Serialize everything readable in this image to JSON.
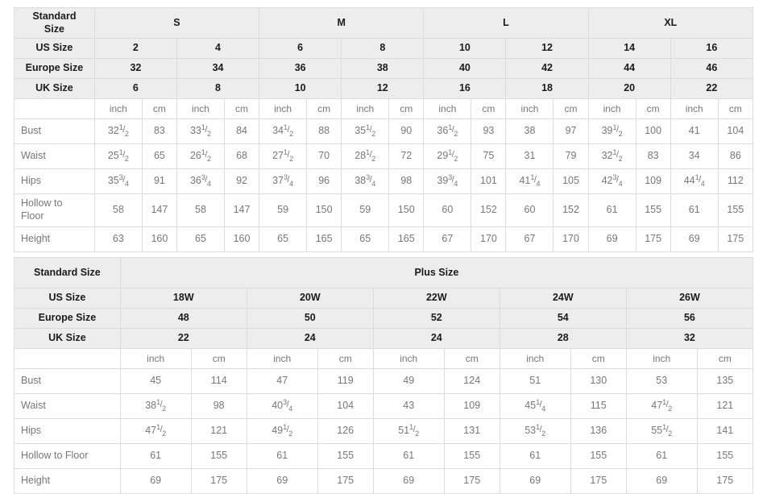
{
  "standard_table": {
    "label_column_header": "Standard\nSize",
    "size_groups": [
      {
        "label": "S",
        "span": 2
      },
      {
        "label": "M",
        "span": 2
      },
      {
        "label": "L",
        "span": 2
      },
      {
        "label": "XL",
        "span": 2
      }
    ],
    "rows": [
      {
        "label": "US Size",
        "values": [
          "2",
          "4",
          "6",
          "8",
          "10",
          "12",
          "14",
          "16"
        ]
      },
      {
        "label": "Europe Size",
        "values": [
          "32",
          "34",
          "36",
          "38",
          "40",
          "42",
          "44",
          "46"
        ]
      },
      {
        "label": "UK Size",
        "values": [
          "6",
          "8",
          "10",
          "12",
          "16",
          "18",
          "20",
          "22"
        ]
      }
    ],
    "unit_row": {
      "label": "",
      "units": [
        "inch",
        "cm",
        "inch",
        "cm",
        "inch",
        "cm",
        "inch",
        "cm",
        "inch",
        "cm",
        "inch",
        "cm",
        "inch",
        "cm",
        "inch",
        "cm"
      ]
    },
    "measurements": [
      {
        "label": "Bust",
        "cells": [
          {
            "whole": "32",
            "num": "1",
            "den": "2"
          },
          {
            "whole": "83"
          },
          {
            "whole": "33",
            "num": "1",
            "den": "2"
          },
          {
            "whole": "84"
          },
          {
            "whole": "34",
            "num": "1",
            "den": "2"
          },
          {
            "whole": "88"
          },
          {
            "whole": "35",
            "num": "1",
            "den": "2"
          },
          {
            "whole": "90"
          },
          {
            "whole": "36",
            "num": "1",
            "den": "2"
          },
          {
            "whole": "93"
          },
          {
            "whole": "38"
          },
          {
            "whole": "97"
          },
          {
            "whole": "39",
            "num": "1",
            "den": "2"
          },
          {
            "whole": "100"
          },
          {
            "whole": "41"
          },
          {
            "whole": "104"
          }
        ]
      },
      {
        "label": "Waist",
        "cells": [
          {
            "whole": "25",
            "num": "1",
            "den": "2"
          },
          {
            "whole": "65"
          },
          {
            "whole": "26",
            "num": "1",
            "den": "2"
          },
          {
            "whole": "68"
          },
          {
            "whole": "27",
            "num": "1",
            "den": "2"
          },
          {
            "whole": "70"
          },
          {
            "whole": "28",
            "num": "1",
            "den": "2"
          },
          {
            "whole": "72"
          },
          {
            "whole": "29",
            "num": "1",
            "den": "2"
          },
          {
            "whole": "75"
          },
          {
            "whole": "31"
          },
          {
            "whole": "79"
          },
          {
            "whole": "32",
            "num": "1",
            "den": "2"
          },
          {
            "whole": "83"
          },
          {
            "whole": "34"
          },
          {
            "whole": "86"
          }
        ]
      },
      {
        "label": "Hips",
        "cells": [
          {
            "whole": "35",
            "num": "3",
            "den": "4"
          },
          {
            "whole": "91"
          },
          {
            "whole": "36",
            "num": "3",
            "den": "4"
          },
          {
            "whole": "92"
          },
          {
            "whole": "37",
            "num": "3",
            "den": "4"
          },
          {
            "whole": "96"
          },
          {
            "whole": "38",
            "num": "3",
            "den": "4"
          },
          {
            "whole": "98"
          },
          {
            "whole": "39",
            "num": "3",
            "den": "4"
          },
          {
            "whole": "101"
          },
          {
            "whole": "41",
            "num": "1",
            "den": "4"
          },
          {
            "whole": "105"
          },
          {
            "whole": "42",
            "num": "3",
            "den": "4"
          },
          {
            "whole": "109"
          },
          {
            "whole": "44",
            "num": "1",
            "den": "4"
          },
          {
            "whole": "112"
          }
        ]
      },
      {
        "label": "Hollow to Floor",
        "cells": [
          {
            "whole": "58"
          },
          {
            "whole": "147"
          },
          {
            "whole": "58"
          },
          {
            "whole": "147"
          },
          {
            "whole": "59"
          },
          {
            "whole": "150"
          },
          {
            "whole": "59"
          },
          {
            "whole": "150"
          },
          {
            "whole": "60"
          },
          {
            "whole": "152"
          },
          {
            "whole": "60"
          },
          {
            "whole": "152"
          },
          {
            "whole": "61"
          },
          {
            "whole": "155"
          },
          {
            "whole": "61"
          },
          {
            "whole": "155"
          }
        ]
      },
      {
        "label": "Height",
        "cells": [
          {
            "whole": "63"
          },
          {
            "whole": "160"
          },
          {
            "whole": "65"
          },
          {
            "whole": "160"
          },
          {
            "whole": "65"
          },
          {
            "whole": "165"
          },
          {
            "whole": "65"
          },
          {
            "whole": "165"
          },
          {
            "whole": "67"
          },
          {
            "whole": "170"
          },
          {
            "whole": "67"
          },
          {
            "whole": "170"
          },
          {
            "whole": "69"
          },
          {
            "whole": "175"
          },
          {
            "whole": "69"
          },
          {
            "whole": "175"
          }
        ]
      }
    ]
  },
  "plus_table": {
    "label_column_header": "Standard Size",
    "group_title": "Plus Size",
    "rows": [
      {
        "label": "US Size",
        "values": [
          "18W",
          "20W",
          "22W",
          "24W",
          "26W"
        ]
      },
      {
        "label": "Europe Size",
        "values": [
          "48",
          "50",
          "52",
          "54",
          "56"
        ]
      },
      {
        "label": "UK Size",
        "values": [
          "22",
          "24",
          "24",
          "28",
          "32"
        ]
      }
    ],
    "unit_row": {
      "label": "",
      "units": [
        "inch",
        "cm",
        "inch",
        "cm",
        "inch",
        "cm",
        "inch",
        "cm",
        "inch",
        "cm"
      ]
    },
    "measurements": [
      {
        "label": "Bust",
        "cells": [
          {
            "whole": "45"
          },
          {
            "whole": "114"
          },
          {
            "whole": "47"
          },
          {
            "whole": "119"
          },
          {
            "whole": "49"
          },
          {
            "whole": "124"
          },
          {
            "whole": "51"
          },
          {
            "whole": "130"
          },
          {
            "whole": "53"
          },
          {
            "whole": "135"
          }
        ]
      },
      {
        "label": "Waist",
        "cells": [
          {
            "whole": "38",
            "num": "1",
            "den": "2"
          },
          {
            "whole": "98"
          },
          {
            "whole": "40",
            "num": "3",
            "den": "4"
          },
          {
            "whole": "104"
          },
          {
            "whole": "43"
          },
          {
            "whole": "109"
          },
          {
            "whole": "45",
            "num": "1",
            "den": "4"
          },
          {
            "whole": "115"
          },
          {
            "whole": "47",
            "num": "1",
            "den": "2"
          },
          {
            "whole": "121"
          }
        ]
      },
      {
        "label": "Hips",
        "cells": [
          {
            "whole": "47",
            "num": "1",
            "den": "2"
          },
          {
            "whole": "121"
          },
          {
            "whole": "49",
            "num": "1",
            "den": "2"
          },
          {
            "whole": "126"
          },
          {
            "whole": "51",
            "num": "1",
            "den": "2"
          },
          {
            "whole": "131"
          },
          {
            "whole": "53",
            "num": "1",
            "den": "2"
          },
          {
            "whole": "136"
          },
          {
            "whole": "55",
            "num": "1",
            "den": "2"
          },
          {
            "whole": "141"
          }
        ]
      },
      {
        "label": "Hollow to Floor",
        "cells": [
          {
            "whole": "61"
          },
          {
            "whole": "155"
          },
          {
            "whole": "61"
          },
          {
            "whole": "155"
          },
          {
            "whole": "61"
          },
          {
            "whole": "155"
          },
          {
            "whole": "61"
          },
          {
            "whole": "155"
          },
          {
            "whole": "61"
          },
          {
            "whole": "155"
          }
        ]
      },
      {
        "label": "Height",
        "cells": [
          {
            "whole": "69"
          },
          {
            "whole": "175"
          },
          {
            "whole": "69"
          },
          {
            "whole": "175"
          },
          {
            "whole": "69"
          },
          {
            "whole": "175"
          },
          {
            "whole": "69"
          },
          {
            "whole": "175"
          },
          {
            "whole": "69"
          },
          {
            "whole": "175"
          }
        ]
      }
    ]
  },
  "colors": {
    "header_bg": "#ededed",
    "header_text": "#1b1b1b",
    "body_text": "#777777",
    "border": "#dcdcdc",
    "page_bg": "#ffffff"
  }
}
